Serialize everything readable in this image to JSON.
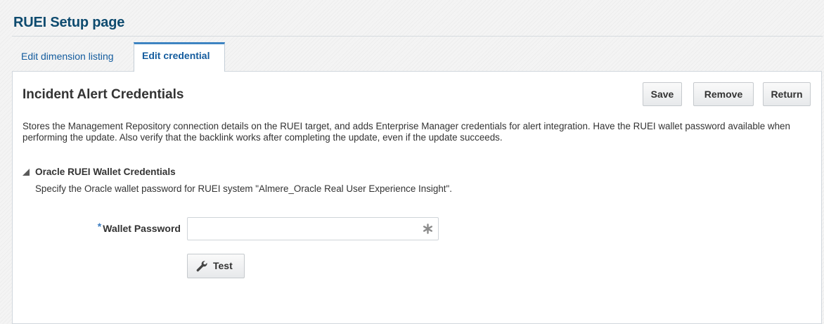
{
  "header": {
    "title": "RUEI Setup page"
  },
  "tabs": [
    {
      "label": "Edit dimension listing",
      "active": false
    },
    {
      "label": "Edit credential",
      "active": true
    }
  ],
  "section": {
    "title": "Incident Alert Credentials",
    "description": "Stores the Management Repository connection details on the RUEI target, and adds Enterprise Manager credentials for alert integration. Have the RUEI wallet password available when performing the update. Also verify that the backlink works after completing the update, even if the update succeeds."
  },
  "actions": {
    "save_label": "Save",
    "remove_label": "Remove",
    "return_label": "Return"
  },
  "wallet": {
    "title": "Oracle RUEI Wallet Credentials",
    "expanded": true,
    "description": "Specify the Oracle wallet password for RUEI system \"Almere_Oracle Real User Experience Insight\".",
    "required_marker": "*",
    "password_label": "Wallet Password",
    "password_value": "",
    "test_label": "Test"
  },
  "colors": {
    "title": "#0e4b6f",
    "link": "#145c9e",
    "active_tab_accent": "#3e84c2",
    "required": "#3a7cc0"
  },
  "icons": {
    "disclosure": "triangle-expanded-icon",
    "password": "asterisk-lock-icon",
    "test": "wrench-icon"
  }
}
